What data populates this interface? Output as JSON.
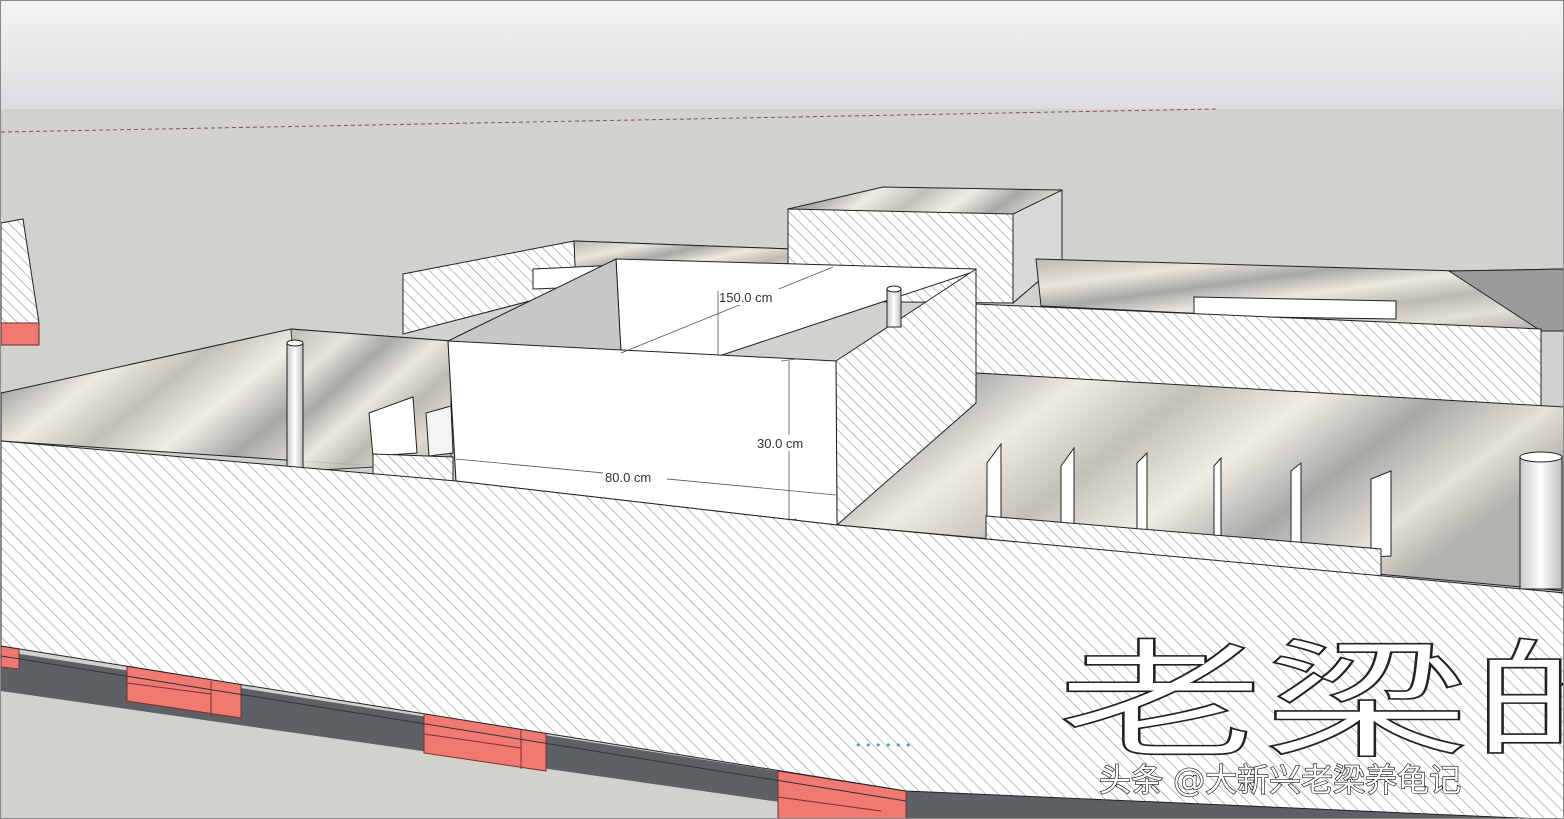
{
  "scene": {
    "app": "3D modeling viewport",
    "dimensions": {
      "length": "150.0 cm",
      "height": "30.0 cm",
      "width": "80.0 cm"
    },
    "signage_text": "老梁的",
    "watermark": "头条 @大新兴老梁养龟记",
    "progress_dots": "• • • • • •",
    "colors": {
      "sky_top": "#dfe0e3",
      "ground": "#d0d0cc",
      "wall_face": "#ffffff",
      "hatch": "#a9a9a9",
      "base_dark": "#5d6166",
      "feet_red": "#f07a72",
      "marble": "#cfccc3"
    }
  }
}
